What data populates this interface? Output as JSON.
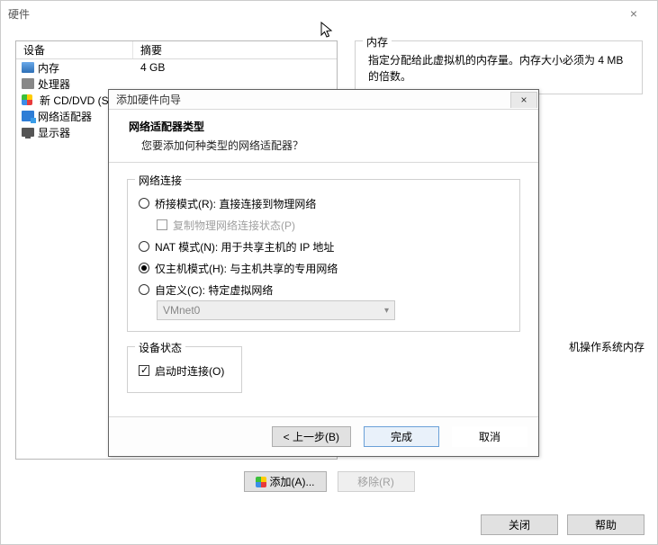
{
  "outer": {
    "title": "硬件",
    "device_header": {
      "col1": "设备",
      "col2": "摘要"
    },
    "devices": [
      {
        "name": "内存",
        "summary": "4 GB",
        "icon": "mem"
      },
      {
        "name": "处理器",
        "summary": "",
        "icon": "cpu"
      },
      {
        "name": "新 CD/DVD (S",
        "summary": "",
        "icon": "cd"
      },
      {
        "name": "网络适配器",
        "summary": "",
        "icon": "net"
      },
      {
        "name": "显示器",
        "summary": "",
        "icon": "disp"
      }
    ],
    "mem_group": {
      "legend": "内存",
      "text_line1": "指定分配给此虚拟机的内存量。内存大小必须为 4 MB",
      "text_line2": "的倍数。"
    },
    "os_note": "机操作系统内存",
    "add_btn": "添加(A)...",
    "remove_btn": "移除(R)",
    "close_btn": "关闭",
    "help_btn": "帮助"
  },
  "wizard": {
    "title": "添加硬件向导",
    "heading": "网络适配器类型",
    "subheading": "您要添加何种类型的网络适配器？",
    "net_group_legend": "网络连接",
    "radios": {
      "bridge": "桥接模式(R): 直接连接到物理网络",
      "replicate": "复制物理网络连接状态(P)",
      "nat": "NAT 模式(N): 用于共享主机的 IP 地址",
      "hostonly": "仅主机模式(H): 与主机共享的专用网络",
      "custom": "自定义(C): 特定虚拟网络"
    },
    "custom_select": "VMnet0",
    "dev_state_legend": "设备状态",
    "connect_label": "启动时连接(O)",
    "back_btn": "< 上一步(B)",
    "finish_btn": "完成",
    "cancel_btn": "取消"
  }
}
